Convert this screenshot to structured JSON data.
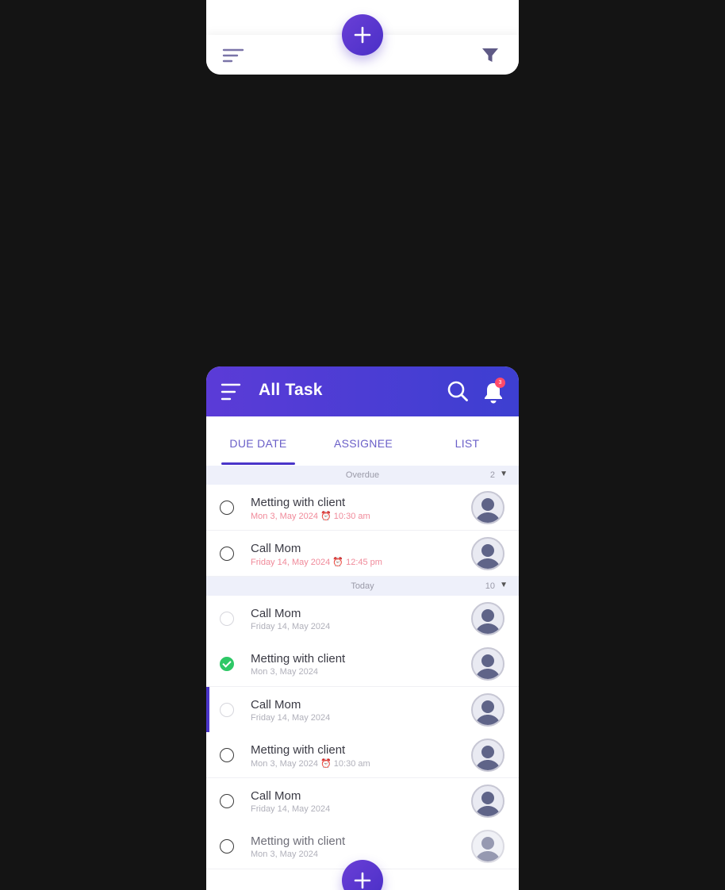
{
  "colors": {
    "accent": "#4a35c9",
    "header_gradient_start": "#5b3bd7",
    "header_gradient_end": "#3d3fd1",
    "overdue": "#f08a9a",
    "done": "#2ec866",
    "badge": "#ff4a6b"
  },
  "top_phone": {
    "icons": {
      "sort": "sort-lines-icon",
      "add": "plus-icon",
      "filter": "funnel-icon"
    }
  },
  "header": {
    "title": "All Task",
    "notification_count": "3"
  },
  "tabs": [
    {
      "label": "DUE DATE",
      "active": true
    },
    {
      "label": "ASSIGNEE",
      "active": false
    },
    {
      "label": "LIST",
      "active": false
    }
  ],
  "sections": [
    {
      "label": "Overdue",
      "count": "2",
      "tasks": [
        {
          "name": "Metting with client",
          "date": "Mon 3, May 2024 ⏰ 10:30 am",
          "state": "open",
          "overdue": true
        },
        {
          "name": "Call Mom",
          "date": "Friday 14, May 2024 ⏰ 12:45 pm",
          "state": "open",
          "overdue": true
        }
      ]
    },
    {
      "label": "Today",
      "count": "10",
      "tasks": [
        {
          "name": "Call Mom",
          "date": "Friday 14, May 2024",
          "state": "faded"
        },
        {
          "name": "Metting with client",
          "date": "Mon 3, May 2024",
          "state": "done"
        },
        {
          "name": "Call Mom",
          "date": "Friday 14, May 2024",
          "state": "faded"
        },
        {
          "name": "Metting with client",
          "date": "Mon 3, May 2024 ⏰ 10:30 am",
          "state": "open"
        },
        {
          "name": "Call Mom",
          "date": "Friday 14, May 2024",
          "state": "open"
        },
        {
          "name": "Metting with client",
          "date": "Mon 3, May 2024",
          "state": "open"
        }
      ]
    }
  ]
}
